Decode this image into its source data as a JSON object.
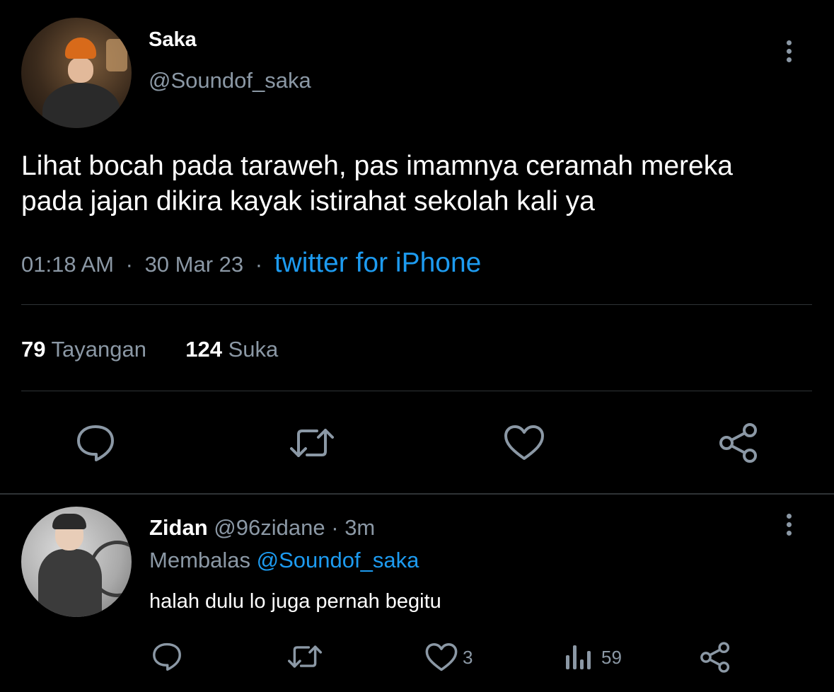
{
  "main_tweet": {
    "author_name": "Saka",
    "author_handle": "@Soundof_saka",
    "text_line1": "Lihat bocah pada taraweh, pas imamnya ceramah mereka",
    "text_line2": "pada jajan dikira kayak istirahat sekolah kali ya",
    "time": "01:18 AM",
    "date": "30 Mar 23",
    "separator": "·",
    "source": "twitter for iPhone",
    "views_count": "79",
    "views_label": "Tayangan",
    "likes_count": "124",
    "likes_label": "Suka"
  },
  "reply": {
    "author_name": "Zidan",
    "author_handle": "@96zidane",
    "time": "3m",
    "separator": "·",
    "replying_label": "Membalas",
    "replying_to": "@Soundof_saka",
    "text": "halah dulu lo juga pernah begitu",
    "like_count": "3",
    "view_count": "59"
  },
  "icons": {
    "main_actions": [
      "reply-icon",
      "retweet-icon",
      "like-icon",
      "share-icon"
    ],
    "reply_actions": [
      "reply-icon",
      "retweet-icon",
      "like-icon",
      "analytics-icon",
      "share-icon"
    ],
    "menu": "more-options-icon"
  },
  "colors": {
    "background": "#000000",
    "primary_text": "#ffffff",
    "secondary_text": "#8b98a5",
    "link": "#1d9bf0",
    "divider": "#2f3336"
  }
}
